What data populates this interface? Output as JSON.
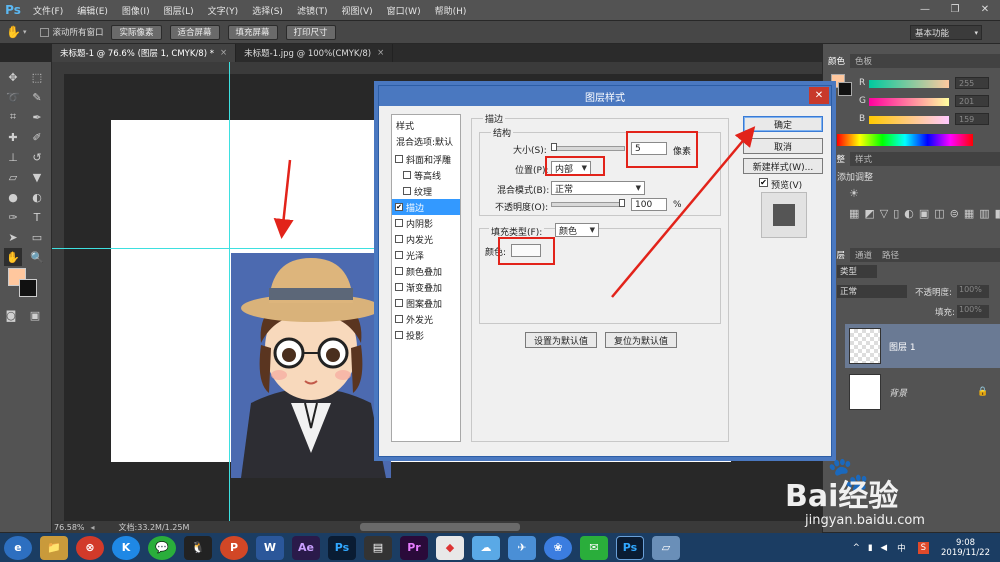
{
  "app": {
    "logo": "Ps"
  },
  "menu": [
    "文件(F)",
    "编辑(E)",
    "图像(I)",
    "图层(L)",
    "文字(Y)",
    "选择(S)",
    "滤镜(T)",
    "视图(V)",
    "窗口(W)",
    "帮助(H)"
  ],
  "options": {
    "scroll_all": "滚动所有窗口",
    "buttons": [
      "实际像素",
      "适合屏幕",
      "填充屏幕",
      "打印尺寸"
    ],
    "workspace": "基本功能"
  },
  "tabs": [
    {
      "label": "未标题-1 @ 76.6% (图层 1, CMYK/8) *",
      "close": "×"
    },
    {
      "label": "未标题-1.jpg @ 100%(CMYK/8)",
      "close": "×"
    }
  ],
  "status": {
    "zoom": "76.58%",
    "doc": "文档:33.2M/1.25M"
  },
  "right_panel": {
    "color_tabs": [
      "颜色",
      "色板"
    ],
    "rgb": [
      {
        "label": "R",
        "value": "255"
      },
      {
        "label": "G",
        "value": "201"
      },
      {
        "label": "B",
        "value": "159"
      }
    ],
    "adj_tabs": [
      "调整",
      "样式"
    ],
    "adj_title": "添加调整",
    "layer_tabs": [
      "图层",
      "通道",
      "路径"
    ],
    "filter_kind": "类型",
    "blend": "正常",
    "opacity_label": "不透明度:",
    "opacity": "100%",
    "fill_label": "填充:",
    "fill": "100%",
    "layers": [
      {
        "name": "图层 1"
      },
      {
        "name": "背景"
      }
    ]
  },
  "dialog": {
    "title": "图层样式",
    "close": "✕",
    "styles_header": "样式",
    "blend_default": "混合选项:默认",
    "styles": [
      {
        "label": "斜面和浮雕",
        "checked": ""
      },
      {
        "label": "等高线",
        "checked": ""
      },
      {
        "label": "纹理",
        "checked": ""
      },
      {
        "label": "描边",
        "checked": "✔"
      },
      {
        "label": "内阴影",
        "checked": ""
      },
      {
        "label": "内发光",
        "checked": ""
      },
      {
        "label": "光泽",
        "checked": ""
      },
      {
        "label": "颜色叠加",
        "checked": ""
      },
      {
        "label": "渐变叠加",
        "checked": ""
      },
      {
        "label": "图案叠加",
        "checked": ""
      },
      {
        "label": "外发光",
        "checked": ""
      },
      {
        "label": "投影",
        "checked": ""
      }
    ],
    "section": "描边",
    "structure": "结构",
    "size_label": "大小(S):",
    "size_value": "5",
    "size_unit": "像素",
    "position_label": "位置(P):",
    "position_value": "内部",
    "blend_label": "混合模式(B):",
    "blend_value": "正常",
    "opacity_label": "不透明度(O):",
    "opacity_value": "100",
    "opacity_unit": "%",
    "fill_type_label": "填充类型(F):",
    "fill_type_value": "颜色",
    "color_label": "颜色:",
    "set_default": "设置为默认值",
    "reset_default": "复位为默认值",
    "ok": "确定",
    "cancel": "取消",
    "new_style": "新建样式(W)...",
    "preview": "预览(V)",
    "preview_checked": "✔"
  },
  "taskbar": {
    "apps": [
      "e",
      "📁",
      "⊗",
      "K",
      "💬",
      "🐧",
      "P",
      "W",
      "Ae",
      "Ps",
      "▤",
      "Pr",
      "◆",
      "☁",
      "✈",
      "❀",
      "✉",
      "Ps",
      "▱"
    ],
    "tray": {
      "ime": "中",
      "time": "9:08",
      "date": "2019/11/22"
    }
  },
  "watermark": {
    "brand": "Bai经验",
    "url": "jingyan.baidu.com"
  },
  "colors": {
    "accent_red": "#e2231a",
    "foreground": "#ffc79e",
    "background": "#111111"
  }
}
